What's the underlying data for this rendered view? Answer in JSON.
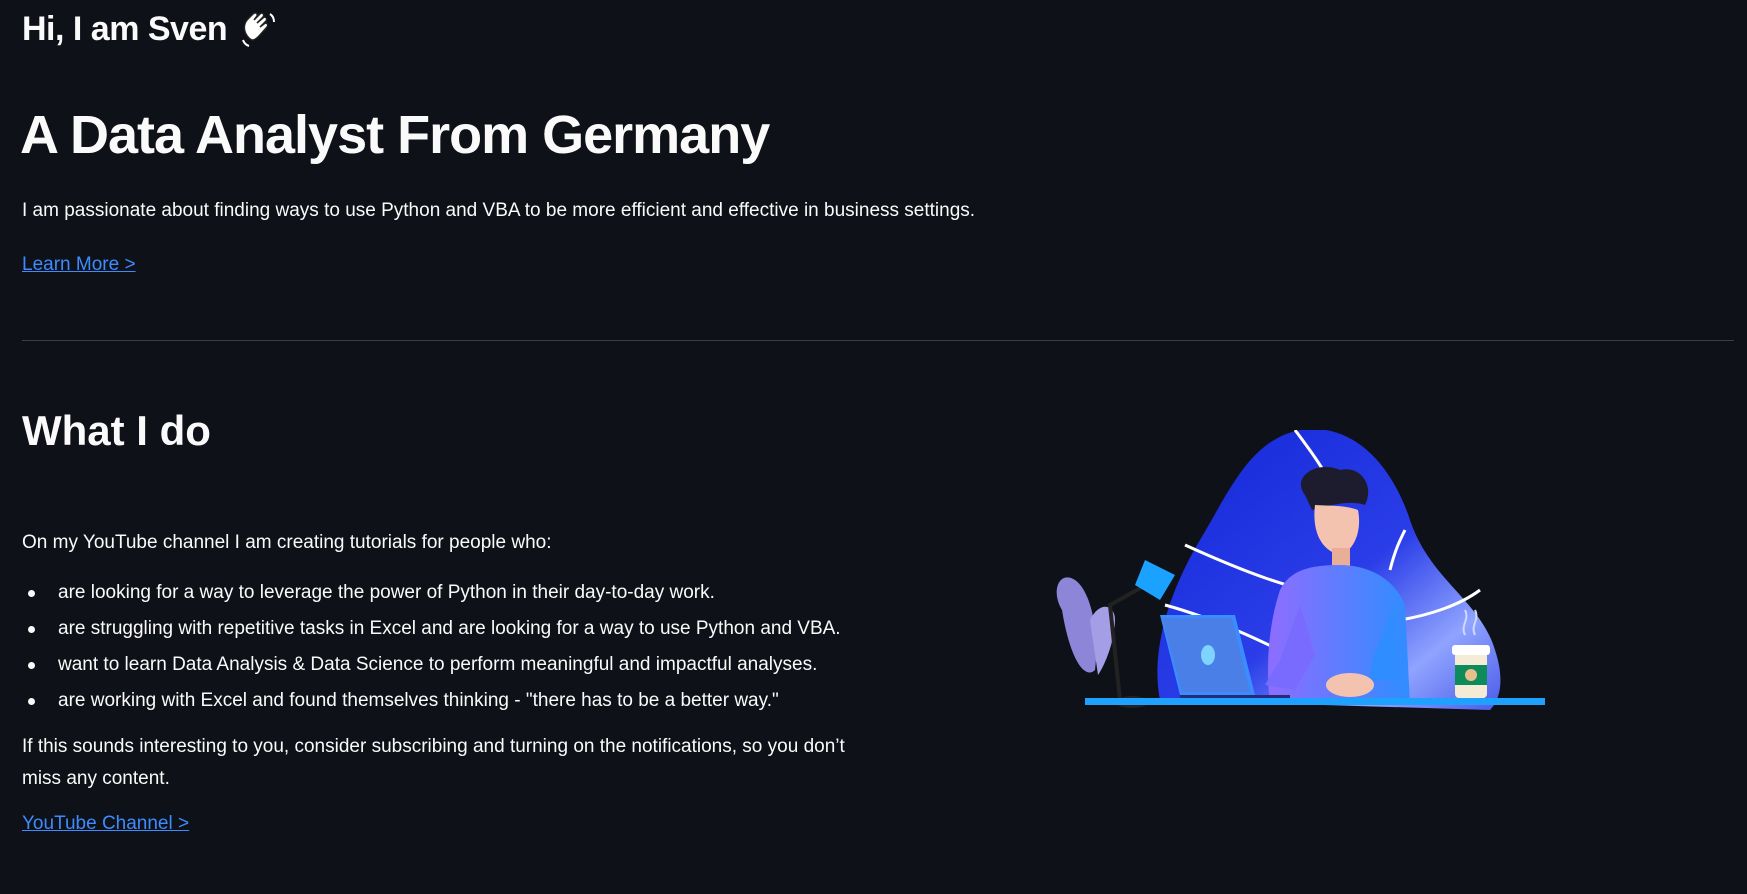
{
  "header": {
    "greeting": "Hi, I am Sven",
    "greeting_icon": "waving-hand-icon"
  },
  "hero": {
    "title": "A Data Analyst From Germany",
    "description": "I am passionate about finding ways to use Python and VBA to be more efficient and effective in business settings.",
    "learn_more_label": "Learn More >"
  },
  "what_i_do": {
    "title": "What I do",
    "intro": "On my YouTube channel I am creating tutorials for people who:",
    "bullets": [
      "are looking for a way to leverage the power of Python in their day-to-day work.",
      "are struggling with repetitive tasks in Excel and are looking for a way to use Python and VBA.",
      "want to learn Data Analysis & Data Science to perform meaningful and impactful analyses.",
      "are working with Excel and found themselves thinking - \"there has to be a better way.\""
    ],
    "outro": "If this sounds interesting to you, consider subscribing and turning on the notifications, so you don’t miss any content.",
    "youtube_label": "YouTube Channel >"
  },
  "colors": {
    "background": "#0e1117",
    "text": "#fafafa",
    "link": "#3d8bff",
    "illustration_blob": "#1a2fe0",
    "illustration_accent": "#3a9bff"
  }
}
